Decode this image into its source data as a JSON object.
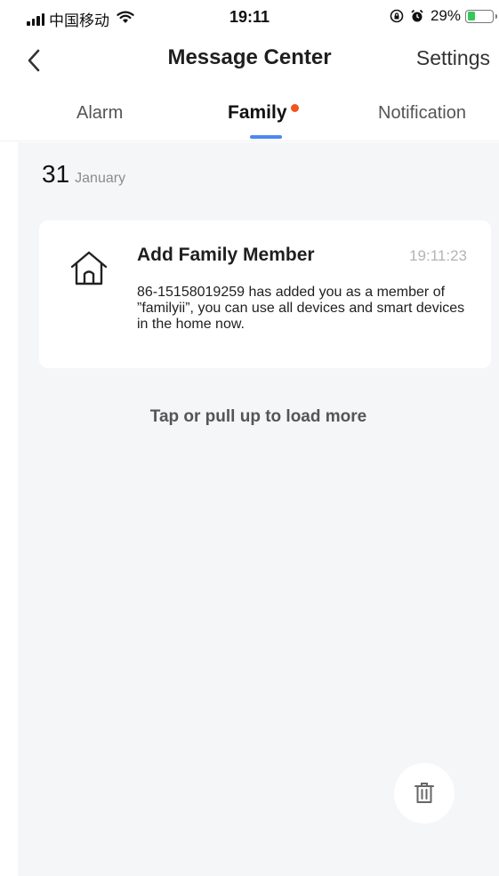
{
  "status_bar": {
    "carrier": "中国移动",
    "time": "19:11",
    "battery": "29%",
    "battery_level": 0.29,
    "signal_icon": "signal-bars-icon",
    "wifi_icon": "wifi-icon",
    "rotation_lock_icon": "rotation-lock-icon",
    "alarm_icon": "alarm-clock-icon"
  },
  "header": {
    "title": "Message Center",
    "settings_label": "Settings",
    "back_icon": "chevron-left-icon"
  },
  "tabs": [
    {
      "label": "Alarm",
      "active": false
    },
    {
      "label": "Family",
      "active": true,
      "has_unread_dot": true
    },
    {
      "label": "Notification",
      "active": false
    }
  ],
  "colors": {
    "accent": "#4d88ef",
    "unread_dot": "#f2541b",
    "battery": "#34c759",
    "background": "#f5f6f8"
  },
  "date_group": {
    "day": "31",
    "month": "January"
  },
  "messages": [
    {
      "icon": "house-icon",
      "title": "Add Family Member",
      "time": "19:11:23",
      "body": "86-15158019259 has added you as a member of ”familyii”, you can use all devices and smart devices in the home now."
    }
  ],
  "load_more_label": "Tap or pull up to load more",
  "trash_icon": "trash-icon"
}
